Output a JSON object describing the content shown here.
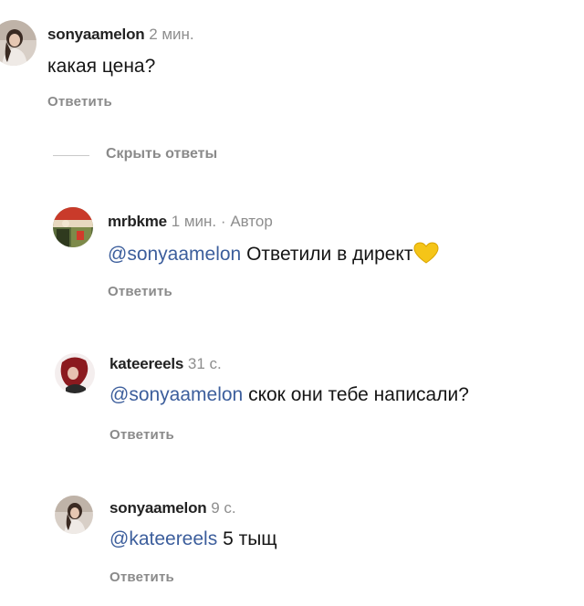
{
  "comments": [
    {
      "username": "sonyaamelon",
      "time": "2 мин.",
      "text": "какая цена?",
      "reply_label": "Ответить"
    },
    {
      "username": "mrbkme",
      "time": "1 мин.",
      "separator": "·",
      "author_label": "Автор",
      "mention": "@sonyaamelon",
      "text": "Ответили в директ",
      "emoji": "yellow-heart-icon",
      "reply_label": "Ответить"
    },
    {
      "username": "kateereels",
      "time": "31 с.",
      "mention": "@sonyaamelon",
      "text": "скок они тебе написали?",
      "reply_label": "Ответить"
    },
    {
      "username": "sonyaamelon",
      "time": "9 с.",
      "mention": "@kateereels",
      "text": "5 тыщ",
      "reply_label": "Ответить"
    }
  ],
  "hide_replies_label": "Скрыть ответы",
  "colors": {
    "mention": "#3c5e9c",
    "muted": "#8e8e8e",
    "heart": "#f5c518"
  }
}
